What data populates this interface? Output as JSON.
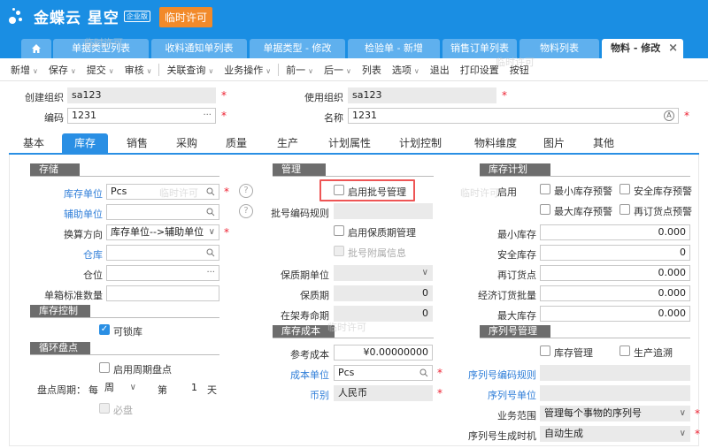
{
  "app": {
    "brand": "金蝶云 星空",
    "edition": "企业版",
    "license_button": "临时许可",
    "watermark": "临时许可"
  },
  "tabs": [
    "单据类型列表",
    "收料通知单列表",
    "单据类型 - 修改",
    "检验单 - 新增",
    "销售订单列表",
    "物料列表",
    "物料 - 修改"
  ],
  "tab_close": "×",
  "toolbar": [
    {
      "label": "新增",
      "menu": true
    },
    {
      "label": "保存",
      "menu": true
    },
    {
      "label": "提交",
      "menu": true
    },
    {
      "label": "审核",
      "menu": true
    },
    {
      "label": "关联查询",
      "menu": true
    },
    {
      "label": "业务操作",
      "menu": true
    },
    {
      "label": "前一",
      "menu": true
    },
    {
      "label": "后一",
      "menu": true
    },
    {
      "label": "列表",
      "menu": false
    },
    {
      "label": "选项",
      "menu": true
    },
    {
      "label": "退出",
      "menu": false
    },
    {
      "label": "打印设置",
      "menu": false
    },
    {
      "label": "按钮",
      "menu": false
    }
  ],
  "chevron": "∨",
  "header": {
    "create_org_label": "创建组织",
    "create_org": "sa123",
    "use_org_label": "使用组织",
    "use_org": "sa123",
    "code_label": "编码",
    "code": "1231",
    "name_label": "名称",
    "name": "1231"
  },
  "section_tabs": [
    "基本",
    "库存",
    "销售",
    "采购",
    "质量",
    "生产",
    "计划属性",
    "计划控制",
    "物料维度",
    "图片",
    "其他"
  ],
  "storage": {
    "title": "存储",
    "stock_unit_label": "库存单位",
    "stock_unit": "Pcs",
    "aux_unit_label": "辅助单位",
    "aux_unit": "",
    "convert_dir_label": "换算方向",
    "convert_dir": "库存单位-->辅助单位",
    "warehouse_label": "仓库",
    "warehouse": "",
    "location_label": "仓位",
    "location": "",
    "box_qty_label": "单箱标准数量",
    "box_qty": ""
  },
  "stock_control": {
    "title": "库存控制",
    "lockable_label": "可锁库",
    "lockable": true
  },
  "cycle_count": {
    "title": "循环盘点",
    "enable_label": "启用周期盘点",
    "period_label": "盘点周期：",
    "every": "每",
    "unit": "周",
    "nth": "第",
    "nth_value": "1",
    "day": "天",
    "checkpoint_label": "必盘"
  },
  "management": {
    "title": "管理",
    "batch_label": "启用批号管理",
    "batch_rule_label": "批号编码规则",
    "shelf_label": "启用保质期管理",
    "batch_attach_label": "批号附属信息",
    "shelf_unit_label": "保质期单位",
    "shelf_period_label": "保质期",
    "shelf_period": "0",
    "shelf_life_label": "在架寿命期",
    "shelf_life": "0"
  },
  "stock_cost": {
    "title": "库存成本",
    "ref_cost_label": "参考成本",
    "ref_cost": "¥0.00000000",
    "cost_unit_label": "成本单位",
    "cost_unit": "Pcs",
    "currency_label": "币别",
    "currency": "人民币"
  },
  "stock_plan": {
    "title": "库存计划",
    "enable_label": "启用",
    "min_warn": "最小库存预警",
    "safe_warn": "安全库存预警",
    "max_warn": "最大库存预警",
    "reorder_warn": "再订货点预警",
    "min_stock_label": "最小库存",
    "min_stock": "0.000",
    "safe_stock_label": "安全库存",
    "safe_stock": "0",
    "reorder_label": "再订货点",
    "reorder": "0.000",
    "eoq_label": "经济订货批量",
    "eoq": "0.000",
    "max_stock_label": "最大库存",
    "max_stock": "0.000"
  },
  "serial": {
    "title": "序列号管理",
    "stock_mgmt_label": "库存管理",
    "prod_trace_label": "生产追溯",
    "rule_label": "序列号编码规则",
    "unit_label": "序列号单位",
    "scope_label": "业务范围",
    "scope": "管理每个事物的序列号",
    "gen_label": "序列号生成时机",
    "gen": "自动生成"
  },
  "colors": {
    "accent": "#1a8ee3",
    "license": "#f28a2a",
    "required": "#e23",
    "highlight": "#e55"
  }
}
